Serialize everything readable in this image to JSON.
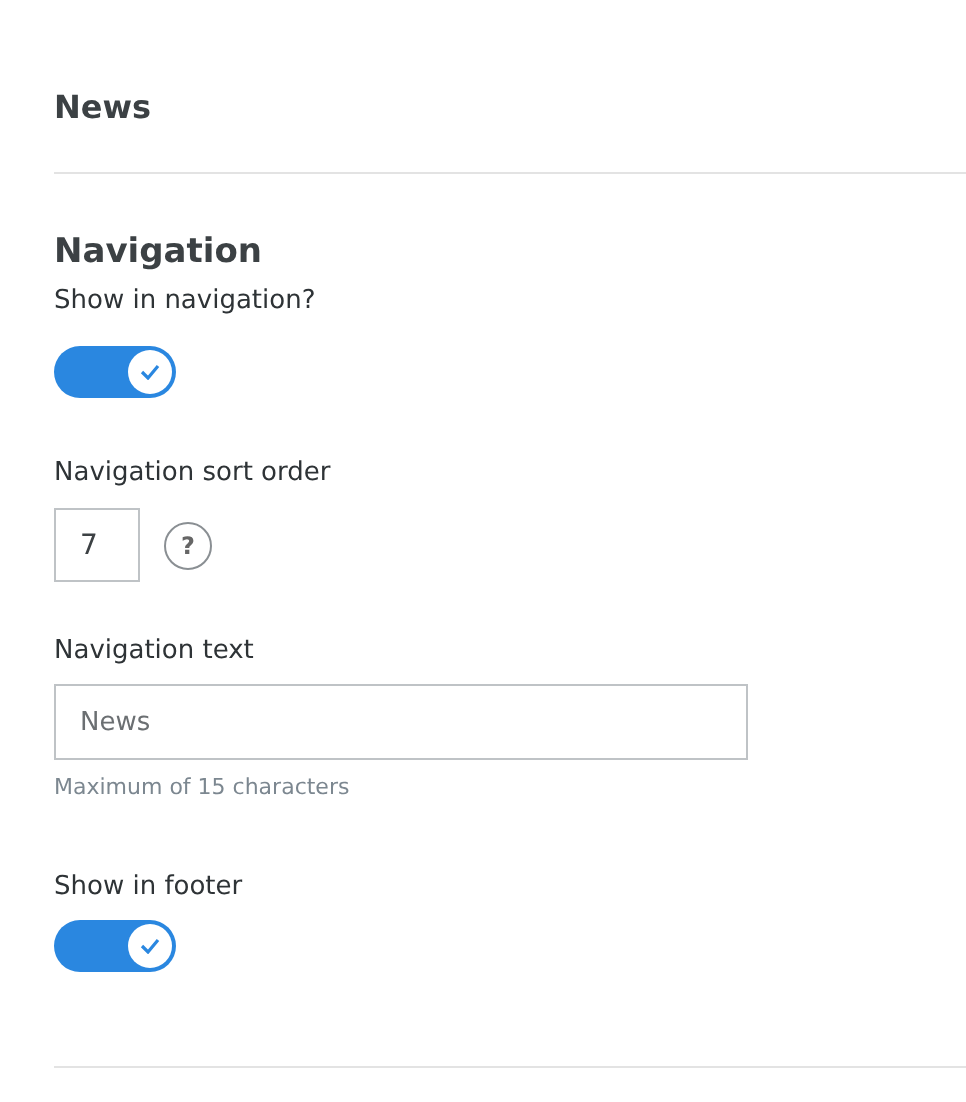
{
  "page_title": "News",
  "section": {
    "title": "Navigation",
    "fields": [
      {
        "kind": "toggle",
        "label": "Show in navigation?",
        "on": true
      },
      {
        "kind": "number",
        "label": "Navigation sort order",
        "value": "7",
        "help": "?"
      },
      {
        "kind": "text",
        "label": "Navigation text",
        "value": "News",
        "hint": "Maximum of 15 characters"
      },
      {
        "kind": "toggle",
        "label": "Show in footer",
        "on": true
      }
    ]
  }
}
